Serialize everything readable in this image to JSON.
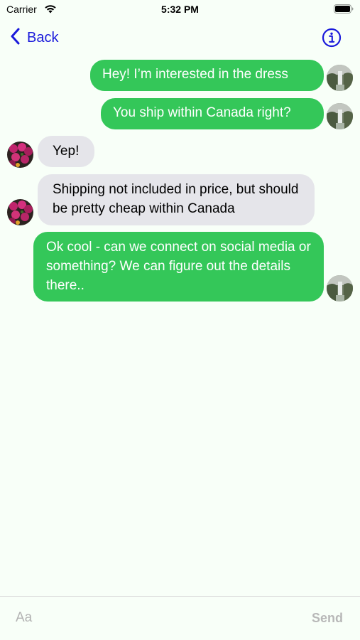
{
  "status_bar": {
    "carrier": "Carrier",
    "time": "5:32 PM",
    "wifi_icon": "wifi-icon",
    "battery_icon": "battery-icon"
  },
  "nav": {
    "back_label": "Back",
    "back_icon": "chevron-left-icon",
    "info_icon": "info-circle-icon",
    "accent_color": "#1A1ADB"
  },
  "messages": [
    {
      "sender": "me",
      "text": "Hey! I’m interested in the dress"
    },
    {
      "sender": "me",
      "text": "You ship within Canada right?"
    },
    {
      "sender": "them",
      "text": "Yep!"
    },
    {
      "sender": "them",
      "text": "Shipping not included in price, but should be pretty cheap within Canada"
    },
    {
      "sender": "me",
      "text": "Ok cool - can we connect on social media or something? We can figure out the details there.."
    }
  ],
  "colors": {
    "sent_bubble": "#34C759",
    "received_bubble": "#E5E5EA",
    "background": "#F8FFF8"
  },
  "composer": {
    "placeholder": "Aa",
    "value": "",
    "send_label": "Send"
  }
}
